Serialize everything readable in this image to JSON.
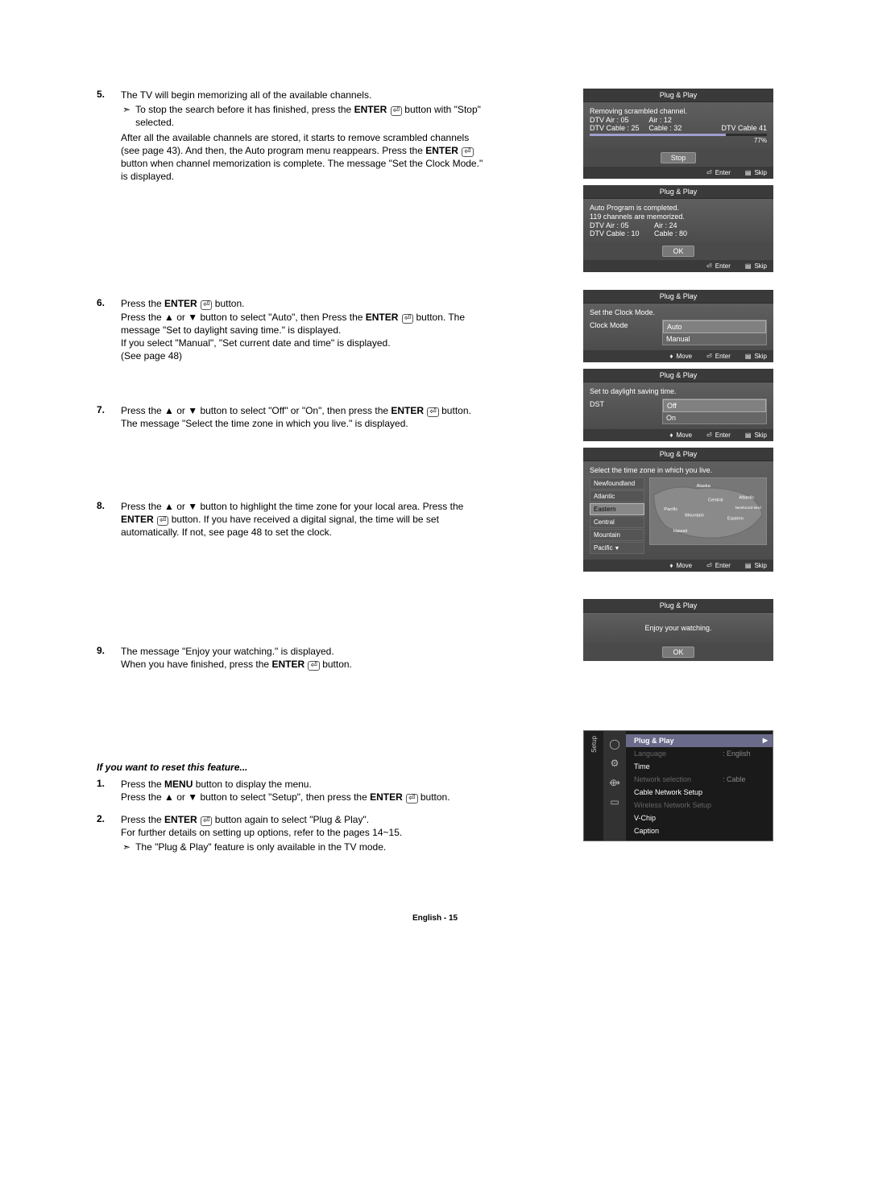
{
  "steps": [
    {
      "num": "5.",
      "lines": [
        "The TV will begin memorizing all of the available channels.",
        {
          "note": true,
          "text": "To stop the search before it has finished, press the <b>ENTER</b> <span class='enter-icon'>⏎</span> button with \"Stop\" selected."
        },
        "After all the available channels are stored, it starts to remove scrambled channels (see page 43). And then, the Auto program menu reappears. Press the <b>ENTER</b> <span class='enter-icon'>⏎</span> button when channel memorization is complete. The message \"Set the Clock Mode.\" is displayed."
      ]
    },
    {
      "num": "6.",
      "lines": [
        "Press the <b>ENTER</b> <span class='enter-icon'>⏎</span> button.",
        "Press the ▲ or ▼ button to select \"Auto\", then Press the <b>ENTER</b> <span class='enter-icon'>⏎</span> button. The message \"Set to daylight saving time.\" is displayed.",
        "If you select \"Manual\", \"Set current date and time\" is displayed.",
        "(See page 48)"
      ]
    },
    {
      "num": "7.",
      "lines": [
        "Press the ▲ or ▼ button to select \"Off\" or \"On\", then press the <b>ENTER</b> <span class='enter-icon'>⏎</span> button. The message \"Select the time zone in which you live.\" is displayed."
      ]
    },
    {
      "num": "8.",
      "lines": [
        "Press the ▲ or ▼ button to highlight the time zone for your local area. Press the <b>ENTER</b> <span class='enter-icon'>⏎</span> button. If you have received a digital signal, the time will be set automatically. If not, see page 48 to set the clock."
      ]
    },
    {
      "num": "9.",
      "lines": [
        "The message \"Enjoy your watching.\" is displayed.",
        "When you have finished, press the <b>ENTER</b> <span class='enter-icon'>⏎</span> button."
      ]
    }
  ],
  "reset": {
    "heading": "If you want to reset this feature...",
    "items": [
      {
        "num": "1.",
        "lines": [
          "Press the <b>MENU</b> button to display the menu.",
          "Press the ▲ or ▼ button to select \"Setup\", then press the <b>ENTER</b> <span class='enter-icon'>⏎</span> button."
        ]
      },
      {
        "num": "2.",
        "lines": [
          "Press the <b>ENTER</b> <span class='enter-icon'>⏎</span> button again to select \"Plug & Play\".",
          "For further details on setting up options, refer to the pages 14~15.",
          {
            "note": true,
            "text": "The \"Plug & Play\" feature is only available in the TV mode."
          }
        ]
      }
    ]
  },
  "osd": {
    "title": "Plug & Play",
    "foot_move": "Move",
    "foot_enter": "Enter",
    "foot_skip": "Skip",
    "scan": {
      "line1": "Removing scrambled channel.",
      "row1a": "DTV Air : 05",
      "row1b": "Air : 12",
      "row2a": "DTV Cable : 25",
      "row2b": "Cable : 32",
      "row2c": "DTV Cable 41",
      "percent": "77%",
      "stop": "Stop"
    },
    "complete": {
      "line1": "Auto Program is completed.",
      "line2": "119 channels are memorized.",
      "row1a": "DTV Air : 05",
      "row1b": "Air : 24",
      "row2a": "DTV Cable : 10",
      "row2b": "Cable : 80",
      "ok": "OK"
    },
    "clockmode": {
      "line1": "Set the Clock Mode.",
      "label": "Clock Mode",
      "opt1": "Auto",
      "opt2": "Manual"
    },
    "dst": {
      "line1": "Set to daylight saving time.",
      "label": "DST",
      "opt1": "Off",
      "opt2": "On"
    },
    "tz": {
      "line1": "Select the time zone in which you live.",
      "items": [
        "Newfoundland",
        "Atlantic",
        "Eastern",
        "Central",
        "Mountain",
        "Pacific"
      ],
      "map_labels": [
        "Alaska",
        "Pacific",
        "Mountain",
        "Central",
        "Eastern",
        "Atlantic",
        "Newfound-land",
        "Hawaii"
      ]
    },
    "enjoy": {
      "msg": "Enjoy your watching.",
      "ok": "OK"
    }
  },
  "setup_menu": {
    "tab_label": "Setup",
    "items": [
      {
        "label": "Plug & Play",
        "sel": true
      },
      {
        "label": "Language",
        "val": ": English",
        "dim": true
      },
      {
        "label": "Time"
      },
      {
        "label": "Network selection",
        "val": ": Cable",
        "dim": true
      },
      {
        "label": "Cable Network Setup"
      },
      {
        "label": "Wireless Network Setup",
        "dim": true
      },
      {
        "label": "V-Chip"
      },
      {
        "label": "Caption"
      }
    ]
  },
  "footer": "English - 15"
}
